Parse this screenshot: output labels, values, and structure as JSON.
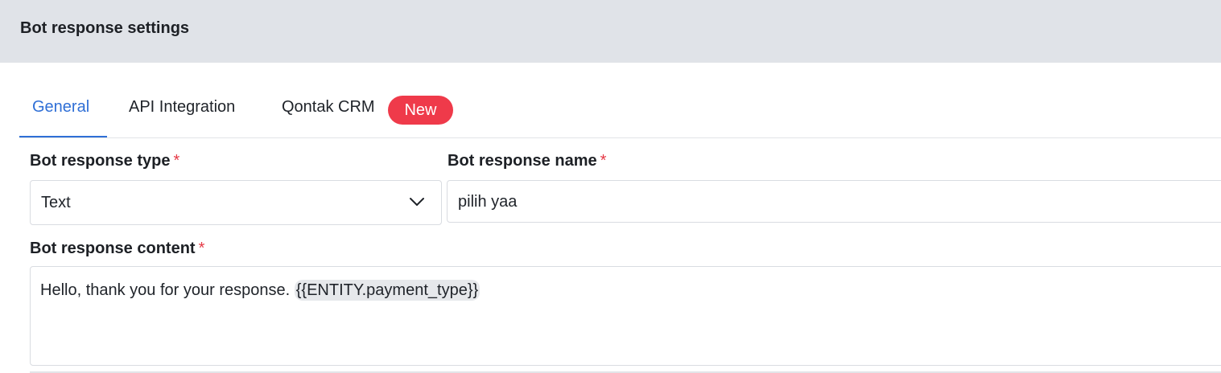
{
  "header": {
    "title": "Bot response settings"
  },
  "tabs": [
    {
      "label": "General",
      "active": true
    },
    {
      "label": "API Integration",
      "active": false
    },
    {
      "label": "Qontak CRM",
      "active": false,
      "badge": "New"
    }
  ],
  "form": {
    "required_marker": "*",
    "type": {
      "label": "Bot response type",
      "value": "Text",
      "icon": "chevron-down-icon"
    },
    "name": {
      "label": "Bot response name",
      "value": "pilih yaa"
    },
    "content": {
      "label": "Bot response content",
      "text": "Hello, thank you for your response. ",
      "entity": "{{ENTITY.payment_type}}"
    }
  },
  "colors": {
    "accent": "#2f6fd6",
    "badge": "#ef3a4a",
    "required": "#e53946",
    "header_bg": "#e0e3e8"
  }
}
